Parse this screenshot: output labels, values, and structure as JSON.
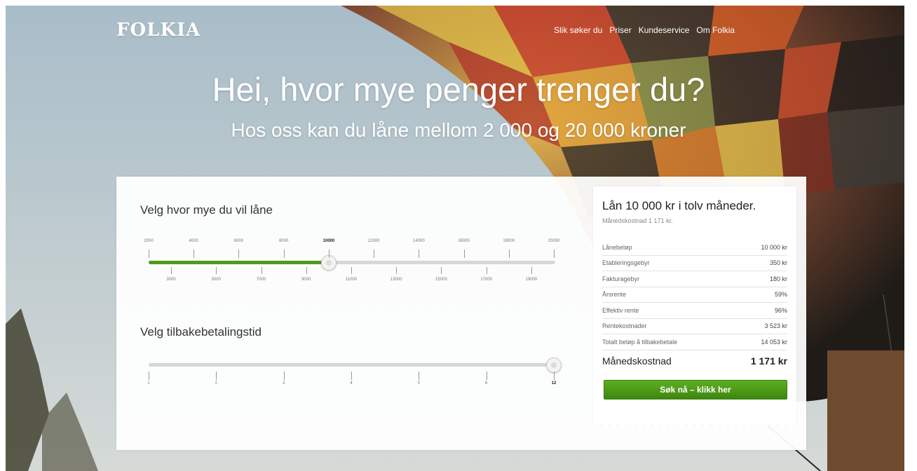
{
  "header": {
    "logo": "FOLKIA",
    "nav": [
      "Slik søker du",
      "Priser",
      "Kundeservice",
      "Om Folkia"
    ]
  },
  "hero": {
    "title": "Hei, hvor mye penger trenger du?",
    "subtitle": "Hos oss kan du låne mellom 2 000 og 20 000 kroner"
  },
  "amount_slider": {
    "label": "Velg hvor mye du vil låne",
    "min": 2000,
    "max": 20000,
    "value": 10000,
    "top_labels": [
      "2000",
      "4000",
      "6000",
      "8000",
      "10000",
      "12000",
      "14000",
      "16000",
      "18000",
      "20000"
    ],
    "bottom_labels": [
      "3000",
      "5000",
      "7000",
      "9000",
      "11000",
      "13000",
      "15000",
      "17000",
      "19000"
    ]
  },
  "term_slider": {
    "label": "Velg tilbakebetalingstid",
    "value": 12,
    "labels": [
      "1",
      "2",
      "3",
      "4",
      "5",
      "6",
      "12"
    ]
  },
  "summary": {
    "title": "Lån 10 000 kr i tolv måneder.",
    "subtitle": "Månedskostnad 1 171 kr.",
    "rows": [
      {
        "label": "Lånebeløp",
        "value": "10 000 kr"
      },
      {
        "label": "Etableringsgebyr",
        "value": "350 kr"
      },
      {
        "label": "Fakturagebyr",
        "value": "180 kr"
      },
      {
        "label": "Årsrente",
        "value": "59%"
      },
      {
        "label": "Effektiv rente",
        "value": "96%"
      },
      {
        "label": "Rentekostnader",
        "value": "3 523 kr"
      },
      {
        "label": "Totalt beløp å tilbakebetale",
        "value": "14 053 kr"
      }
    ],
    "total": {
      "label": "Månedskostnad",
      "value": "1 171 kr"
    },
    "cta": "Søk nå – klikk her"
  },
  "colors": {
    "accent_green": "#4d9c1c",
    "button_green": "#4a9a18"
  }
}
